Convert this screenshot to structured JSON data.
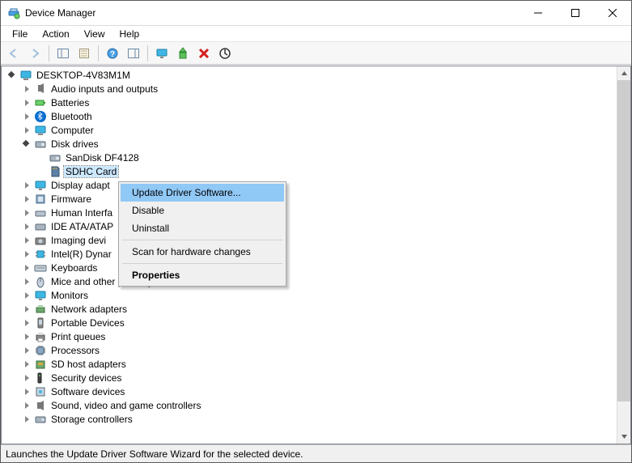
{
  "window": {
    "title": "Device Manager"
  },
  "menubar": {
    "file": "File",
    "action": "Action",
    "view": "View",
    "help": "Help"
  },
  "titlebar_buttons": {
    "min": "Minimize",
    "max": "Maximize",
    "close": "Close"
  },
  "toolbar_icons": {
    "back": "back-arrow-icon",
    "forward": "forward-arrow-icon",
    "show_hide": "show-hide-console-tree-icon",
    "properties": "properties-icon",
    "help": "help-icon",
    "action_window": "show-actions-icon",
    "monitor": "display-devices-icon",
    "update": "update-driver-icon",
    "uninstall": "uninstall-icon",
    "scan": "scan-hardware-icon"
  },
  "tree": {
    "root": "DESKTOP-4V83M1M",
    "categories": [
      {
        "label": "Audio inputs and outputs"
      },
      {
        "label": "Batteries"
      },
      {
        "label": "Bluetooth"
      },
      {
        "label": "Computer"
      },
      {
        "label": "Disk drives",
        "expanded": true,
        "children": [
          {
            "label": "SanDisk DF4128"
          },
          {
            "label": "SDHC Card",
            "selected": true
          }
        ]
      },
      {
        "label": "Display adapt"
      },
      {
        "label": "Firmware"
      },
      {
        "label": "Human Interfa"
      },
      {
        "label": "IDE ATA/ATAP"
      },
      {
        "label": "Imaging devi"
      },
      {
        "label": "Intel(R) Dynar"
      },
      {
        "label": "Keyboards"
      },
      {
        "label": "Mice and other pointing devices"
      },
      {
        "label": "Monitors"
      },
      {
        "label": "Network adapters"
      },
      {
        "label": "Portable Devices"
      },
      {
        "label": "Print queues"
      },
      {
        "label": "Processors"
      },
      {
        "label": "SD host adapters"
      },
      {
        "label": "Security devices"
      },
      {
        "label": "Software devices"
      },
      {
        "label": "Sound, video and game controllers"
      },
      {
        "label": "Storage controllers"
      }
    ]
  },
  "context_menu": {
    "update": "Update Driver Software...",
    "disable": "Disable",
    "uninstall": "Uninstall",
    "scan": "Scan for hardware changes",
    "properties": "Properties"
  },
  "statusbar": {
    "text": "Launches the Update Driver Software Wizard for the selected device."
  }
}
